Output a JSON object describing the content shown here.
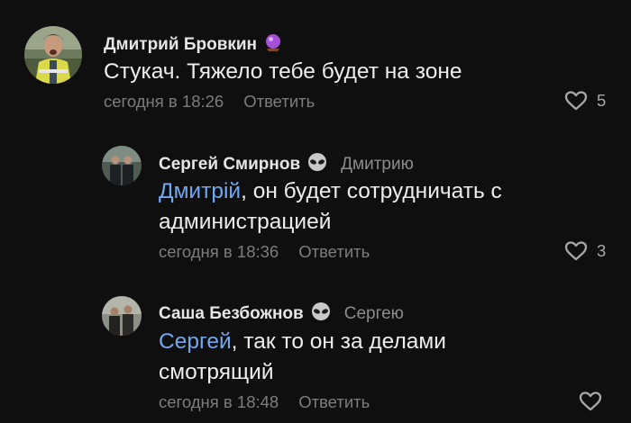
{
  "comments": [
    {
      "author": "Дмитрий Бровкин",
      "badge_icon": "crystal-ball-icon",
      "reply_to": "",
      "mention": "",
      "text": "Стукач. Тяжело тебе будет на зоне",
      "time": "сегодня в 18:26",
      "reply_label": "Ответить",
      "likes": "5"
    },
    {
      "author": "Сергей Смирнов",
      "badge_icon": "alien-icon",
      "reply_to": "Дмитрию",
      "mention": "Дмитрій",
      "text": ", он будет сотрудничать с администрацией",
      "time": "сегодня в 18:36",
      "reply_label": "Ответить",
      "likes": "3"
    },
    {
      "author": "Саша Безбожнов",
      "badge_icon": "alien-icon",
      "reply_to": "Сергею",
      "mention": "Сергей",
      "text": ", так то он за делами смотрящий",
      "time": "сегодня в 18:48",
      "reply_label": "Ответить",
      "likes": ""
    }
  ],
  "colors": {
    "background": "#0f0f0f",
    "mention": "#71a8f0",
    "meta": "#7d7d7d"
  }
}
